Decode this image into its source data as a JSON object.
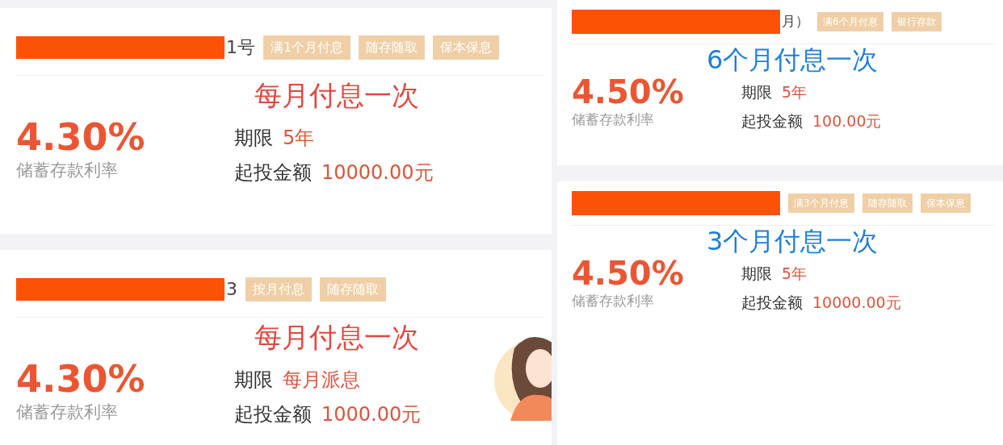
{
  "left_column": [
    {
      "title_tail": "1号",
      "tags": [
        "满1个月付息",
        "随存随取",
        "保本保息"
      ],
      "annotation": {
        "text": "每月付息一次",
        "color": "#e2473f"
      },
      "rate": "4.30%",
      "rate_label": "储蓄存款利率",
      "term_label": "期限",
      "term": "5年",
      "min_label": "起投金额",
      "min_amount": "10000.00元",
      "avatar": false
    },
    {
      "title_tail": "3",
      "tags": [
        "按月付息",
        "随存随取"
      ],
      "annotation": {
        "text": "每月付息一次",
        "color": "#e2473f"
      },
      "rate": "4.30%",
      "rate_label": "储蓄存款利率",
      "term_label": "期限",
      "term": "每月派息",
      "min_label": "起投金额",
      "min_amount": "1000.00元",
      "avatar": true
    }
  ],
  "right_column": [
    {
      "title_tail": "月）",
      "tags": [
        "满6个月付息",
        "银行存款"
      ],
      "annotation": {
        "text": "6个月付息一次",
        "color": "#1f7fd8"
      },
      "rate": "4.50%",
      "rate_label": "储蓄存款利率",
      "term_label": "期限",
      "term": "5年",
      "min_label": "起投金额",
      "min_amount": "100.00元",
      "avatar": false
    },
    {
      "tags": [
        "满3个月付息",
        "随存随取",
        "保本保息"
      ],
      "annotation": {
        "text": "3个月付息一次",
        "color": "#1f7fd8"
      },
      "rate": "4.50%",
      "rate_label": "储蓄存款利率",
      "term_label": "期限",
      "term": "5年",
      "min_label": "起投金额",
      "min_amount": "10000.00元",
      "avatar": false
    }
  ]
}
